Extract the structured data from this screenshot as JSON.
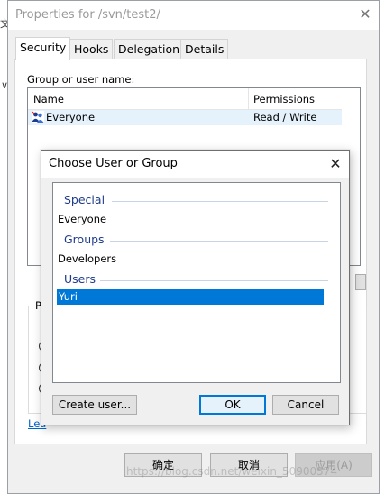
{
  "background": {
    "glyph_1": "文",
    "glyph_2": "∨"
  },
  "properties": {
    "title": "Properties for /svn/test2/",
    "close_glyph": "✕",
    "tabs": [
      {
        "label": "Security",
        "active": true
      },
      {
        "label": "Hooks",
        "active": false
      },
      {
        "label": "Delegation",
        "active": false
      },
      {
        "label": "Details",
        "active": false
      }
    ],
    "group_label": "Group or user name:",
    "columns": {
      "name": "Name",
      "permissions": "Permissions"
    },
    "rows": [
      {
        "name": "Everyone",
        "permissions": "Read / Write",
        "icon": "users-icon"
      }
    ],
    "perm_group_caption": "P",
    "learn_link": "Lea",
    "buttons": {
      "ok": "确定",
      "cancel": "取消",
      "apply": "应用(A)"
    }
  },
  "choose_dialog": {
    "title": "Choose User or Group",
    "close_glyph": "✕",
    "categories": {
      "special": {
        "label": "Special",
        "entries": [
          "Everyone"
        ]
      },
      "groups": {
        "label": "Groups",
        "entries": [
          "Developers"
        ]
      },
      "users": {
        "label": "Users",
        "entries": [
          "Yuri"
        ]
      }
    },
    "selected": "Yuri",
    "buttons": {
      "create_user": "Create user...",
      "ok": "OK",
      "cancel": "Cancel"
    }
  },
  "watermark": "https://blog.csdn.net/weixin_50900574",
  "colors": {
    "accent": "#0078d7",
    "category_text": "#1f3c88",
    "link": "#0066cc"
  }
}
